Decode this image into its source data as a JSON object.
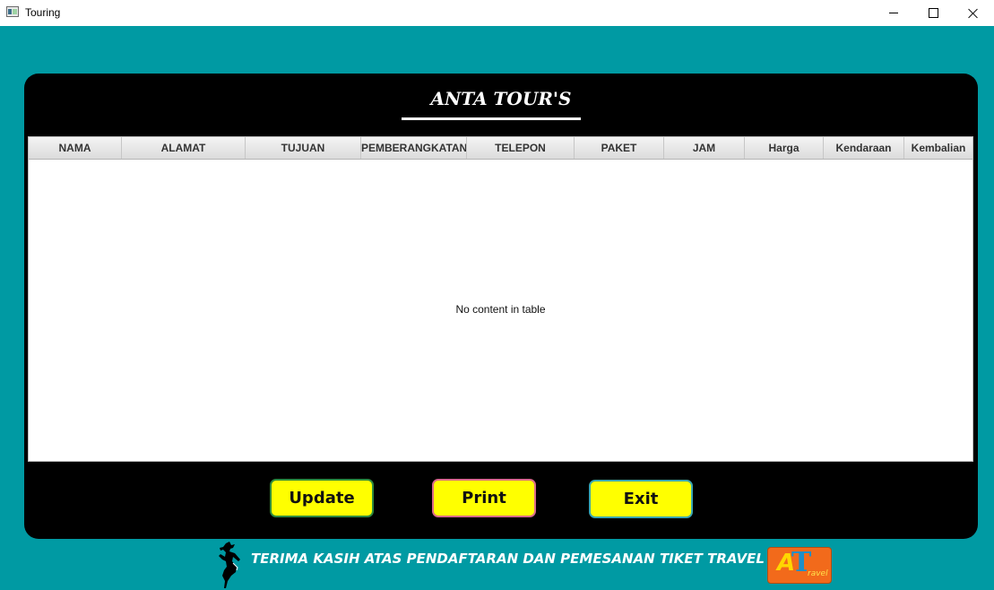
{
  "window": {
    "title": "Touring",
    "icon": "app-window-icon",
    "controls": [
      "minimize-icon",
      "maximize-icon",
      "close-icon"
    ]
  },
  "header": {
    "title": "ANTA TOUR'S"
  },
  "table": {
    "columns": [
      "NAMA",
      "ALAMAT",
      "TUJUAN",
      "PEMBERANGKATAN",
      "TELEPON",
      "PAKET",
      "JAM",
      "Harga",
      "Kendaraan",
      "Kembalian"
    ],
    "rows": [],
    "empty_message": "No content in table"
  },
  "actions": {
    "update_label": "Update",
    "print_label": "Print",
    "exit_label": "Exit"
  },
  "footer": {
    "message": "TERIMA KASIH ATAS PENDAFTARAN DAN PEMESANAN TIKET TRAVEL",
    "logo": {
      "letters_a": "A",
      "letters_t": "T",
      "sub": "ravel"
    }
  },
  "colors": {
    "background": "#009aa3",
    "panel": "#000000",
    "button": "#ffff00",
    "logo": "#f26a1b"
  }
}
